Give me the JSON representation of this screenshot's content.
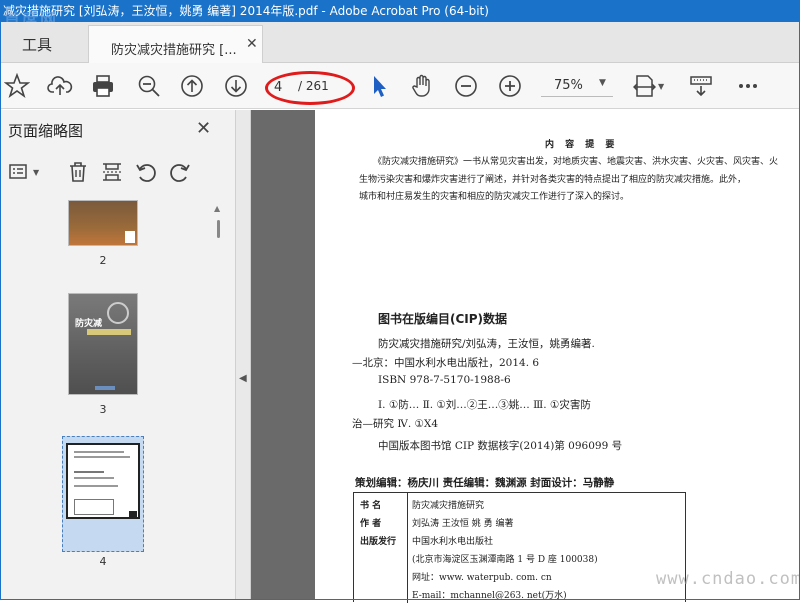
{
  "window": {
    "title": "减灾措施研究 [刘弘涛，王汝恒，姚勇 编著] 2014年版.pdf - Adobe Acrobat Pro (64-bit)",
    "logo_watermark": "首席网"
  },
  "tabs": {
    "tools_label": "工具",
    "document_label": "防灾减灾措施研究 [..."
  },
  "toolbar": {
    "current_page": "4",
    "total_pages": "/ 261",
    "zoom": "75%"
  },
  "sidebar": {
    "title": "页面缩略图",
    "thumbnails": [
      {
        "label": "2"
      },
      {
        "label": "3"
      },
      {
        "label": "4"
      }
    ]
  },
  "page": {
    "summary_heading": "内 容 提 要",
    "summary_lines": [
      "《防灾减灾措施研究》一书从常见灾害出发，对地质灾害、地震灾害、洪水灾害、火灾害、风灾害、火",
      "生物污染灾害和爆炸灾害进行了阐述，并针对各类灾害的特点提出了相应的防灾减灾措施。此外，",
      "城市和村庄易发生的灾害和相应的防灾减灾工作进行了深入的探讨。"
    ],
    "cip_title": "图书在版编目(CIP)数据",
    "cip_lines": [
      "防灾减灾措施研究/刘弘涛，王汝恒，姚勇编著.",
      "—北京：中国水利水电出版社，2014. 6",
      "ISBN 978-7-5170-1988-6",
      "Ⅰ. ①防…  Ⅱ. ①刘…②王…③姚…  Ⅲ. ①灾害防",
      "治—研究  Ⅳ. ①X4",
      "中国版本图书馆 CIP 数据核字(2014)第 096099 号"
    ],
    "editors_line": "策划编辑：杨庆川    责任编辑：魏渊源    封面设计：马静静",
    "info_table": [
      {
        "key": "书    名",
        "value": "防灾减灾措施研究"
      },
      {
        "key": "作    者",
        "value": "刘弘涛    王汝恒    姚 勇    编著"
      },
      {
        "key": "出版发行",
        "value": "中国水利水电出版社"
      },
      {
        "key": "",
        "value": "(北京市海淀区玉渊潭南路 1 号 D 座 100038)"
      },
      {
        "key": "",
        "value": "网址：www. waterpub. com. cn"
      },
      {
        "key": "",
        "value": "E-mail：mchannel@263. net(万水)"
      }
    ]
  },
  "site_watermark": "www.cndao.com",
  "colors": {
    "titlebar": "#1a73c8",
    "highlight_ellipse": "#e01b1b",
    "select_cursor": "#1e5fc4"
  }
}
